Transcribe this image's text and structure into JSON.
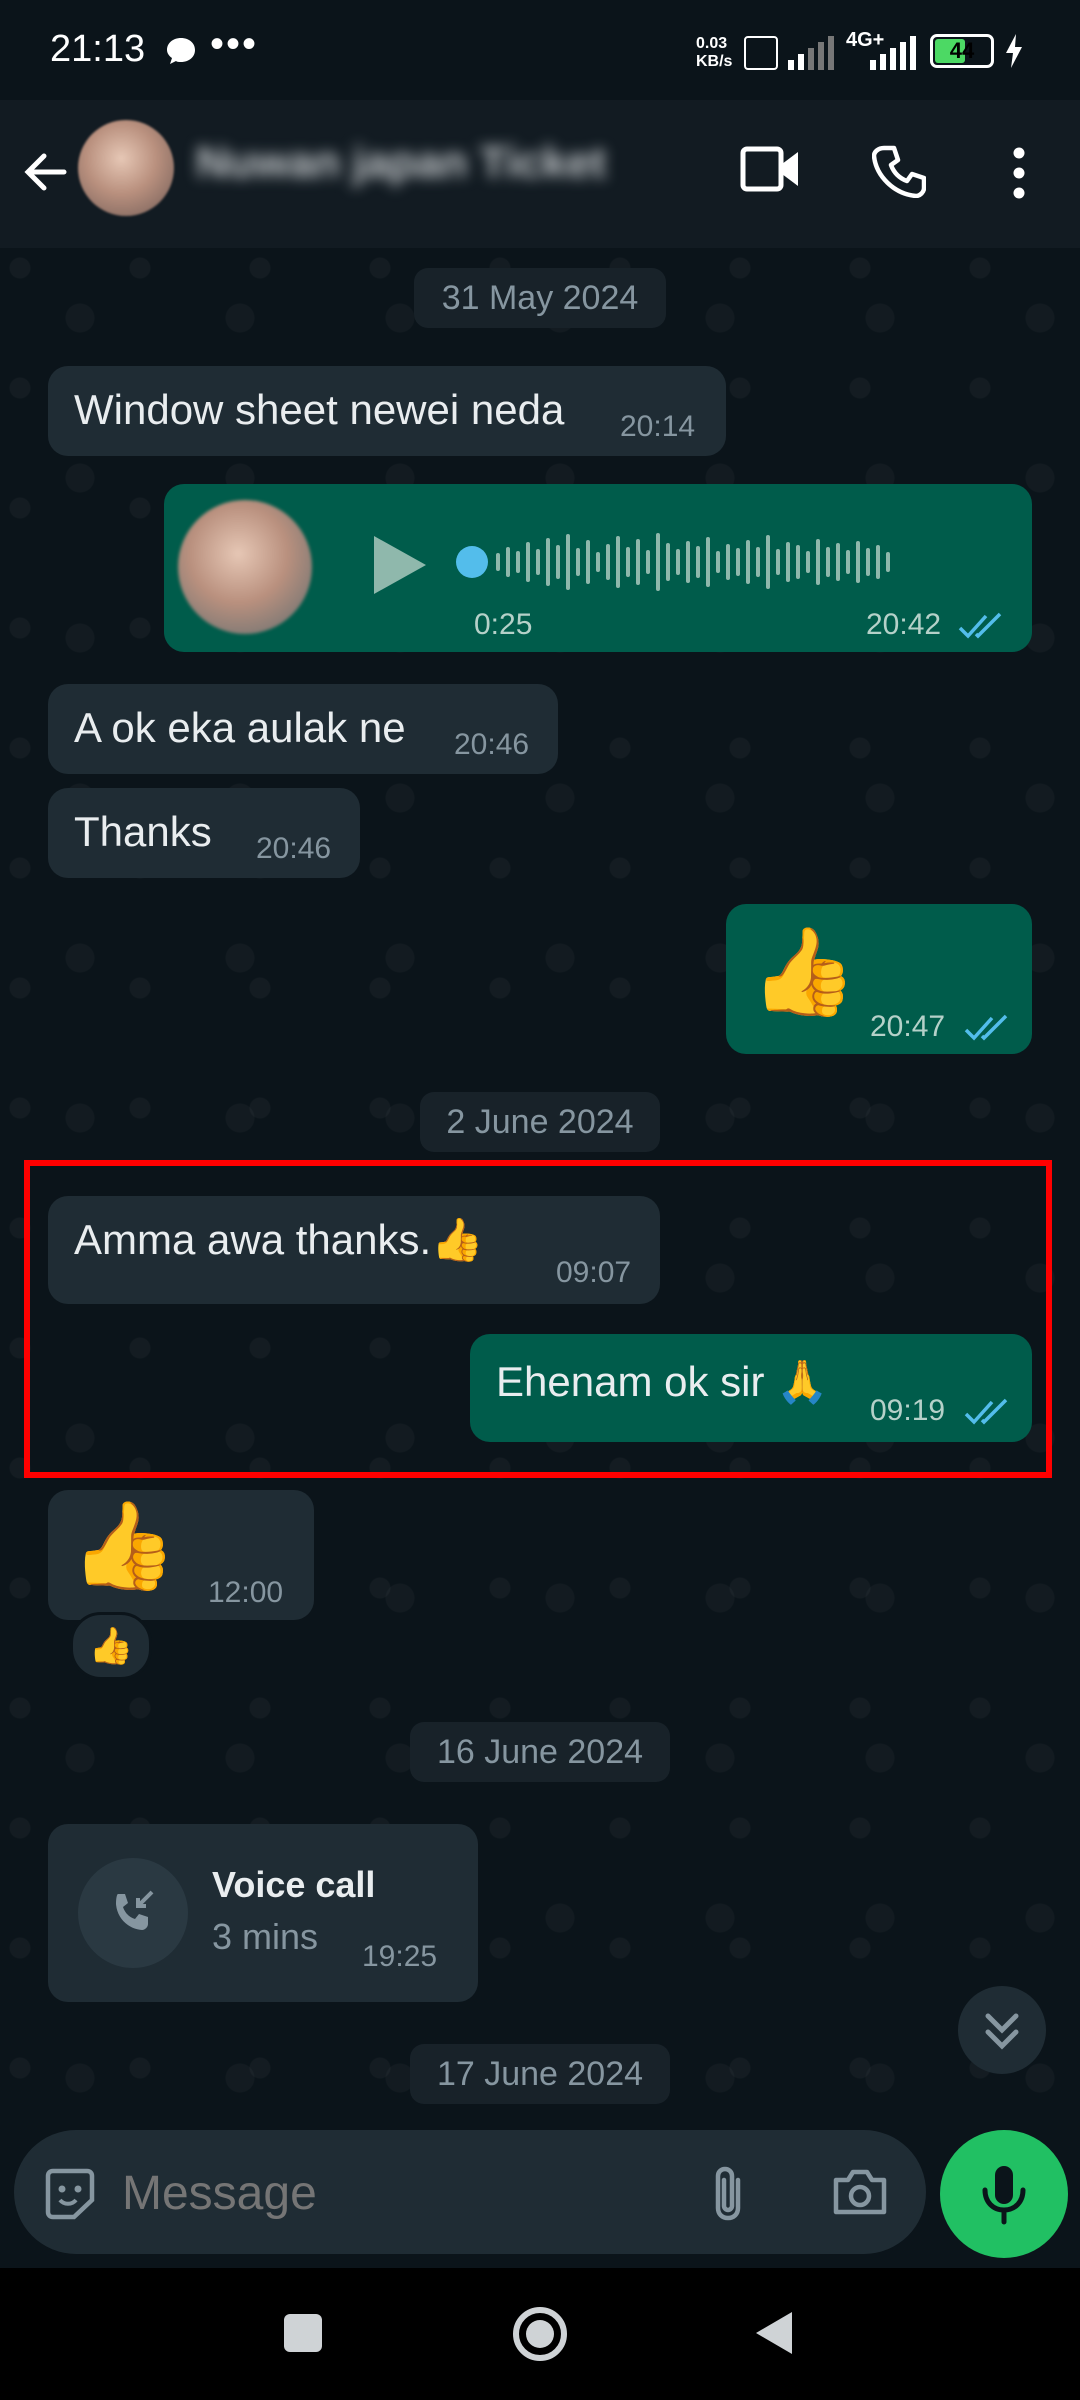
{
  "status_bar": {
    "time": "21:13",
    "more": "•••",
    "data_speed": "0.03",
    "data_unit": "KB/s",
    "network_type": "4G+",
    "battery": "44"
  },
  "header": {
    "contact_name": "Nuwan japan Ticket"
  },
  "messages": {
    "date1": "31 May 2024",
    "m1_text": "Window sheet newei neda",
    "m1_time": "20:14",
    "voice_duration": "0:25",
    "voice_time": "20:42",
    "m3_text": "A ok eka aulak ne",
    "m3_time": "20:46",
    "m4_text": "Thanks",
    "m4_time": "20:46",
    "m5_emoji": "👍",
    "m5_time": "20:47",
    "date2": "2 June 2024",
    "m6_text": "Amma awa thanks.👍",
    "m6_time": "09:07",
    "m7_text": "Ehenam ok sir 🙏",
    "m7_time": "09:19",
    "m8_emoji": "👍",
    "m8_time": "12:00",
    "m8_reaction": "👍",
    "date3": "16 June 2024",
    "call_title": "Voice call",
    "call_duration": "3 mins",
    "call_time": "19:25",
    "date4": "17 June 2024"
  },
  "input": {
    "placeholder": "Message"
  },
  "colors": {
    "background": "#0b141a",
    "incoming_bubble": "#1f2c34",
    "outgoing_bubble": "#005c4b",
    "read_ticks": "#53bdeb",
    "mic_button": "#21c063",
    "highlight": "#ff0000"
  },
  "icons": [
    "back-arrow-icon",
    "video-call-icon",
    "phone-icon",
    "more-vert-icon",
    "play-icon",
    "double-check-icon",
    "incoming-call-icon",
    "scroll-down-icon",
    "sticker-icon",
    "attach-icon",
    "camera-icon",
    "mic-icon",
    "nav-recents-icon",
    "nav-home-icon",
    "nav-back-icon"
  ]
}
